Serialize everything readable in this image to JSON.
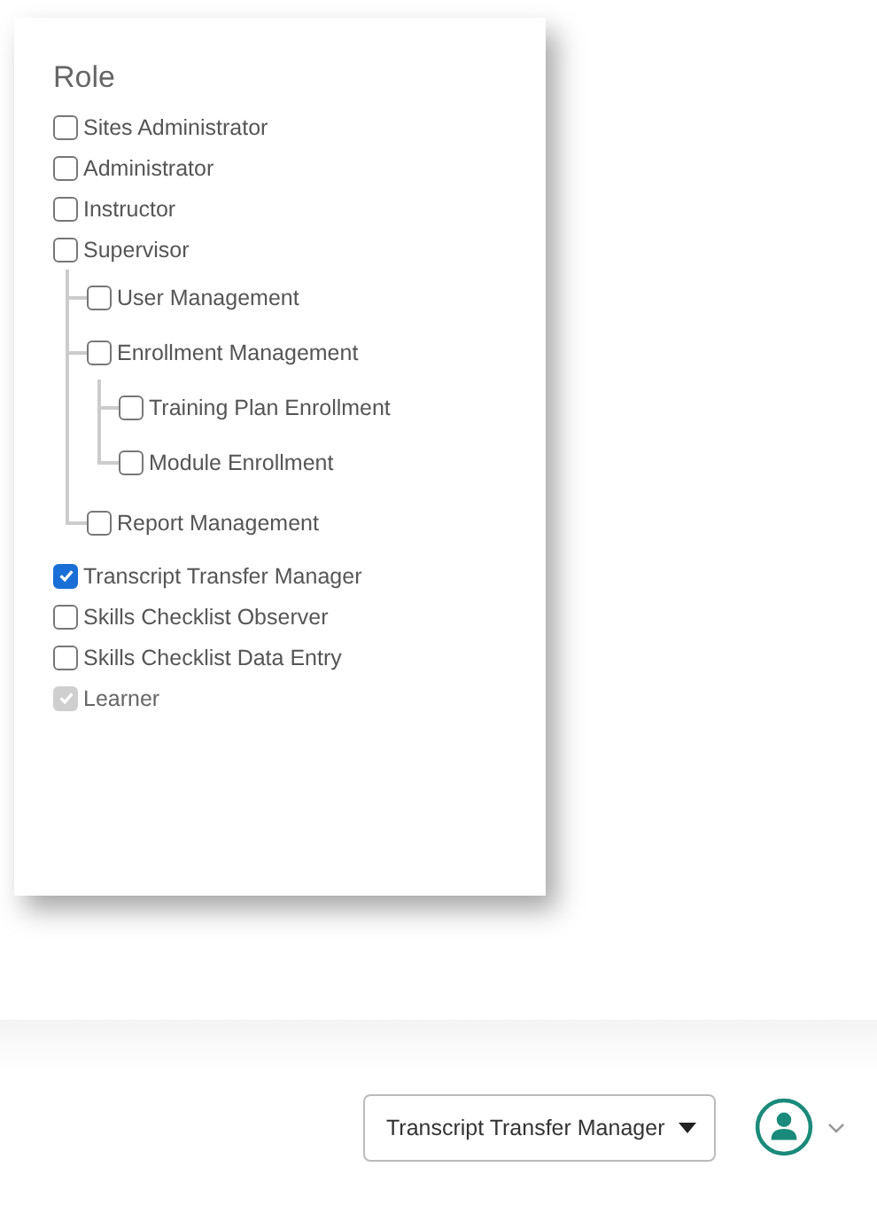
{
  "panel": {
    "title": "Role",
    "roles": [
      {
        "label": "Sites Administrator",
        "checked": false,
        "disabled": false
      },
      {
        "label": "Administrator",
        "checked": false,
        "disabled": false
      },
      {
        "label": "Instructor",
        "checked": false,
        "disabled": false
      },
      {
        "label": "Supervisor",
        "checked": false,
        "disabled": false,
        "children": [
          {
            "label": "User Management",
            "checked": false,
            "disabled": false
          },
          {
            "label": "Enrollment Management",
            "checked": false,
            "disabled": false,
            "children": [
              {
                "label": "Training Plan Enrollment",
                "checked": false,
                "disabled": false
              },
              {
                "label": "Module Enrollment",
                "checked": false,
                "disabled": false
              }
            ]
          },
          {
            "label": "Report Management",
            "checked": false,
            "disabled": false
          }
        ]
      },
      {
        "label": "Transcript Transfer Manager",
        "checked": true,
        "disabled": false
      },
      {
        "label": "Skills Checklist Observer",
        "checked": false,
        "disabled": false
      },
      {
        "label": "Skills Checklist Data Entry",
        "checked": false,
        "disabled": false
      },
      {
        "label": "Learner",
        "checked": true,
        "disabled": true
      }
    ]
  },
  "role_switcher": {
    "label": "Transcript Transfer Manager"
  }
}
